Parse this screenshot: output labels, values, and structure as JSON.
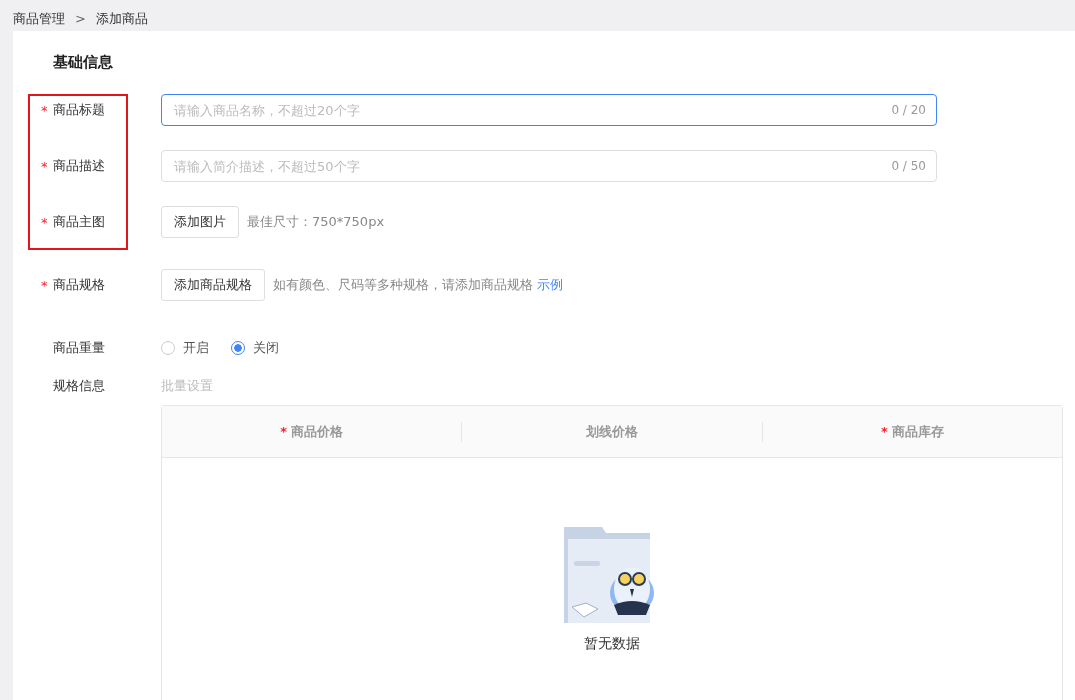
{
  "breadcrumb": [
    {
      "label": "商品管理"
    },
    {
      "label": "添加商品"
    }
  ],
  "breadcrumb_separator": ">",
  "required_mark": "*",
  "section_title": "基础信息",
  "fields": [
    {
      "kind": "input",
      "label": "商品标题",
      "required": true,
      "placeholder": "请输入商品名称，不超过20个字",
      "counter": "0 / 20",
      "focused": true
    },
    {
      "kind": "input",
      "label": "商品描述",
      "required": true,
      "placeholder": "请输入简介描述，不超过50个字",
      "counter": "0 / 50",
      "focused": false
    },
    {
      "kind": "upload",
      "label": "商品主图",
      "required": true,
      "button": "添加图片",
      "hint": "最佳尺寸：750*750px"
    },
    {
      "kind": "upload",
      "label": "商品规格",
      "required": true,
      "button": "添加商品规格",
      "hint": "如有颜色、尺码等多种规格，请添加商品规格",
      "link": "示例"
    },
    {
      "kind": "radio",
      "label": "商品重量",
      "required": false,
      "options": [
        {
          "label": "开启",
          "selected": false
        },
        {
          "label": "关闭",
          "selected": true
        }
      ]
    },
    {
      "kind": "batch",
      "label": "规格信息",
      "required": false,
      "link": "批量设置"
    }
  ],
  "table": {
    "columns": [
      {
        "label": "商品价格",
        "required": true
      },
      {
        "label": "划线价格",
        "required": false
      },
      {
        "label": "商品库存",
        "required": true
      }
    ],
    "empty_text": "暂无数据"
  }
}
